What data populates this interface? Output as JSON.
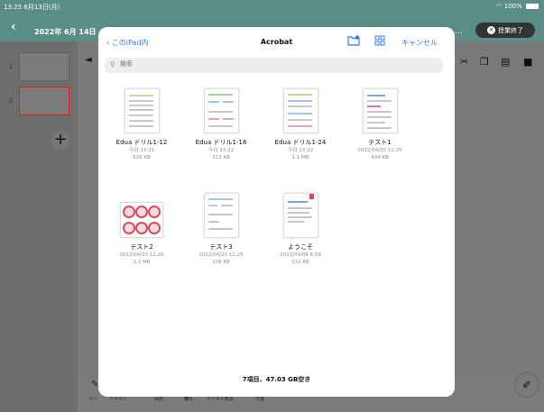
{
  "status_bar": {
    "time": "13:25",
    "date": "6月13日(月)",
    "battery": "100%"
  },
  "app_header": {
    "date": "2022年 6月 14日",
    "end_button": "授業終了",
    "more": "…"
  },
  "page_list": {
    "pages": [
      "1",
      "2"
    ]
  },
  "bottom_tabs": [
    "ペン",
    "テキスト",
    "図形",
    "挿入",
    "デジタル教具",
    "付箋"
  ],
  "file_picker": {
    "back_label": "このiPad内",
    "title": "Acrobat",
    "cancel_label": "キャンセル",
    "search_placeholder": "検索",
    "files": [
      {
        "name": "Edua ドリル1-12",
        "date": "今日 13:21",
        "size": "620 KB"
      },
      {
        "name": "Edua ドリル1-18",
        "date": "今日 13:22",
        "size": "312 KB"
      },
      {
        "name": "Edua ドリル1-24",
        "date": "今日 13:22",
        "size": "1.1 MB"
      },
      {
        "name": "テスト1",
        "date": "2022/04/20 11:25",
        "size": "434 KB"
      },
      {
        "name": "テスト2",
        "date": "2022/04/20 11:26",
        "size": "1.2 MB"
      },
      {
        "name": "テスト3",
        "date": "2022/04/20 11:25",
        "size": "238 KB"
      },
      {
        "name": "ようこそ",
        "date": "2022/04/08 6:59",
        "size": "232 KB"
      }
    ],
    "footer": "7項目、47.03 GB空き"
  },
  "colors": {
    "accent": "#2f7bf5",
    "header": "#5b8d87",
    "selected_page_border": "#e02020"
  }
}
